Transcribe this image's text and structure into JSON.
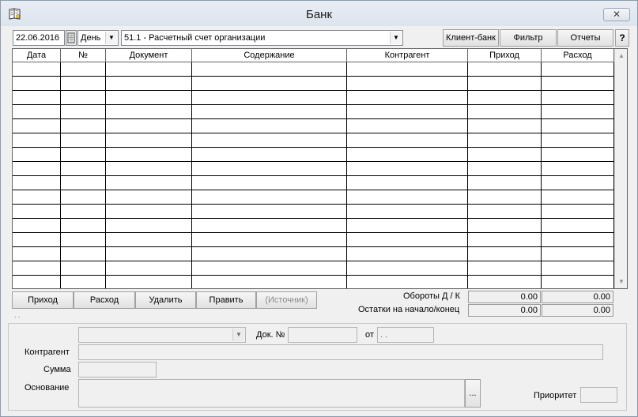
{
  "window": {
    "title": "Банк",
    "close_label": "✕"
  },
  "toolbar": {
    "date_value": "22.06.2016",
    "calendar_icon": "calendar-icon",
    "period_value": "День",
    "account_value": "51.1 - Расчетный счет организации",
    "client_bank_label": "Клиент-банк",
    "filter_label": "Фильтр",
    "reports_label": "Отчеты",
    "help_label": "?"
  },
  "grid": {
    "columns": [
      "Дата",
      "№",
      "Документ",
      "Содержание",
      "Контрагент",
      "Приход",
      "Расход"
    ]
  },
  "actions": {
    "income_label": "Приход",
    "expense_label": "Расход",
    "delete_label": "Удалить",
    "edit_label": "Править",
    "source_label": "(Источник)"
  },
  "totals": {
    "turnover_label": "Обороты Д / К",
    "balance_label": "Остатки на начало/конец",
    "turnover_debit": "0.00",
    "turnover_credit": "0.00",
    "balance_start": "0.00",
    "balance_end": "0.00"
  },
  "status_mark": ". .",
  "details": {
    "doc_no_label": "Док. №",
    "from_label": "от",
    "date_value": " .  .",
    "counterparty_label": "Контрагент",
    "sum_label": "Сумма",
    "basis_label": "Основание",
    "basis_button_label": "...",
    "priority_label": "Приоритет"
  }
}
